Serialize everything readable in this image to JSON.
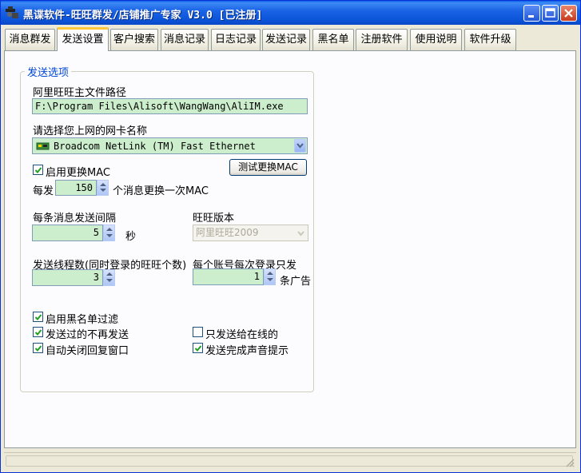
{
  "window": {
    "title": "黑谍软件-旺旺群发/店铺推广专家 V3.0 [已注册]",
    "app_icon": "spy-icon",
    "controls": [
      "minimize-icon",
      "maximize-icon",
      "close-icon"
    ]
  },
  "tabs": [
    {
      "label": "消息群发",
      "active": false
    },
    {
      "label": "发送设置",
      "active": true
    },
    {
      "label": "客户搜索",
      "active": false
    },
    {
      "label": "消息记录",
      "active": false
    },
    {
      "label": "日志记录",
      "active": false
    },
    {
      "label": "发送记录",
      "active": false
    },
    {
      "label": "黑名单",
      "active": false
    },
    {
      "label": "注册软件",
      "active": false
    },
    {
      "label": "使用说明",
      "active": false
    },
    {
      "label": "软件升级",
      "active": false
    }
  ],
  "send_options": {
    "group_title": "发送选项",
    "aliwangwang_path_label": "阿里旺旺主文件路径",
    "aliwangwang_path_value": "F:\\Program Files\\Alisoft\\WangWang\\AliIM.exe",
    "nic_label": "请选择您上网的网卡名称",
    "nic_value": "Broadcom NetLink (TM) Fast Ethernet",
    "nic_icon": "network-card-icon",
    "enable_mac_change": {
      "label": "启用更换MAC",
      "checked": true
    },
    "test_mac_button": "测试更换MAC",
    "every_prefix": "每发",
    "every_value": "150",
    "every_suffix": "个消息更换一次MAC",
    "interval_label": "每条消息发送间隔",
    "interval_value": "5",
    "interval_unit": "秒",
    "version_label": "旺旺版本",
    "version_value": "阿里旺旺2009",
    "version_disabled": true,
    "threads_label": "发送线程数(同时登录的旺旺个数)",
    "threads_value": "3",
    "per_account_label": "每个账号每次登录只发",
    "per_account_value": "1",
    "per_account_unit": "条广告",
    "checkboxes": [
      {
        "label": "启用黑名单过滤",
        "checked": true
      },
      {
        "label": "发送过的不再发送",
        "checked": true
      },
      {
        "label": "只发送给在线的",
        "checked": false
      },
      {
        "label": "自动关闭回复窗口",
        "checked": true
      },
      {
        "label": "发送完成声音提示",
        "checked": true
      }
    ]
  },
  "colors": {
    "titlebar": "#0A5FE8",
    "field_bg": "#CCEECC",
    "group_title": "#0046D5",
    "active_tab_highlight": "#FFC83C"
  }
}
